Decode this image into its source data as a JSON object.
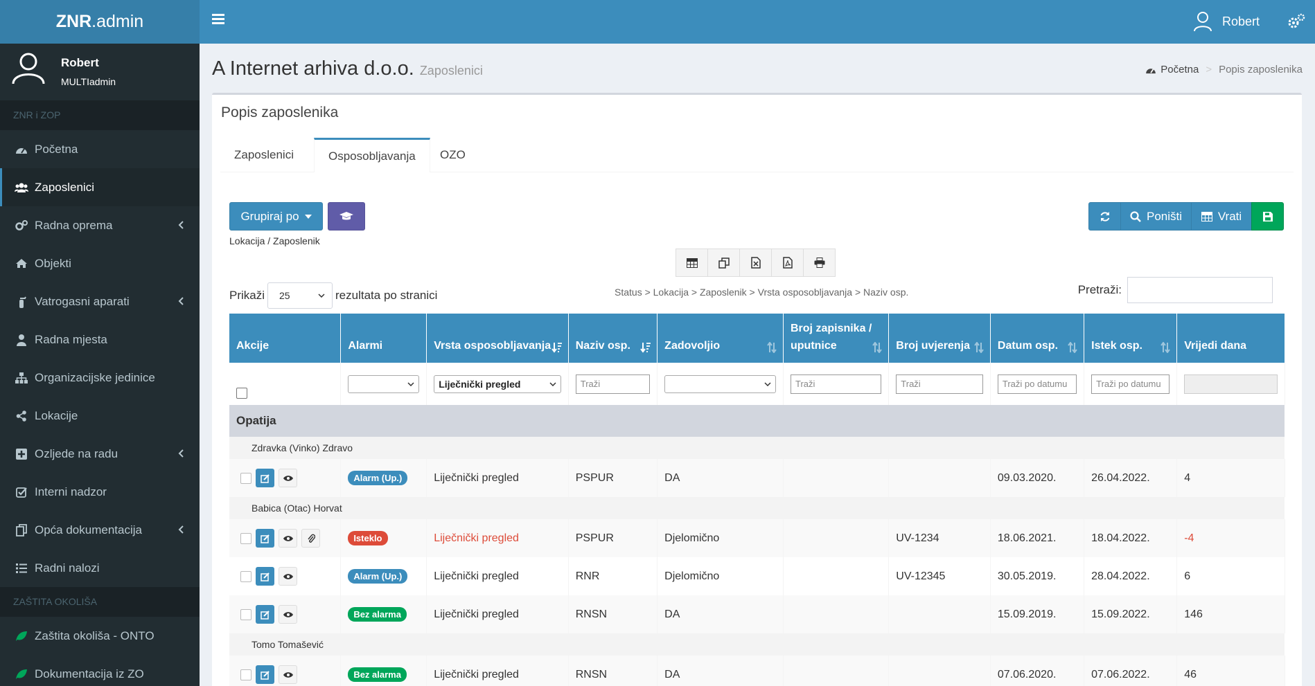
{
  "app": {
    "logo_bold": "ZNR",
    "logo_rest": ".admin"
  },
  "topbar": {
    "user": "Robert"
  },
  "user_panel": {
    "name": "Robert",
    "role": "MULTIadmin"
  },
  "sidebar": {
    "section1": "ZNR i ZOP",
    "items": [
      {
        "label": "Početna"
      },
      {
        "label": "Zaposlenici"
      },
      {
        "label": "Radna oprema"
      },
      {
        "label": "Objekti"
      },
      {
        "label": "Vatrogasni aparati"
      },
      {
        "label": "Radna mjesta"
      },
      {
        "label": "Organizacijske jedinice"
      },
      {
        "label": "Lokacije"
      },
      {
        "label": "Ozljede na radu"
      },
      {
        "label": "Interni nadzor"
      },
      {
        "label": "Opća dokumentacija"
      },
      {
        "label": "Radni nalozi"
      }
    ],
    "section2": "ZAŠTITA OKOLIŠA",
    "items2": [
      {
        "label": "Zaštita okoliša - ONTO"
      },
      {
        "label": "Dokumentacija iz ZO"
      }
    ]
  },
  "page": {
    "title": "A Internet arhiva d.o.o.",
    "subtitle": "Zaposlenici",
    "breadcrumb_home": "Početna",
    "breadcrumb_current": "Popis zaposlenika"
  },
  "box": {
    "title": "Popis zaposlenika",
    "tabs": [
      "Zaposlenici",
      "Osposobljavanja",
      "OZO"
    ],
    "group_button": "Grupiraj po",
    "group_label": "Lokacija / Zaposlenik",
    "reset_button": "Poništi",
    "restore_button": "Vrati"
  },
  "table_controls": {
    "show_prefix": "Prikaži",
    "page_length": "25",
    "show_suffix": "rezultata po stranici",
    "filter_path": "Status > Lokacija > Zaposlenik > Vrsta osposobljavanja > Naziv osp.",
    "search_label": "Pretraži:"
  },
  "table": {
    "headers": [
      "Akcije",
      "Alarmi",
      "Vrsta osposobljavanja",
      "Naziv osp.",
      "Zadovoljio",
      "Broj zapisnika / uputnice",
      "Broj uvjerenja",
      "Datum osp.",
      "Istek osp.",
      "Vrijedi dana"
    ],
    "filters": {
      "vrsta": "Liječnički pregled",
      "trazi": "Traži",
      "trazi_datum": "Traži po datumu"
    },
    "group": "Opatija",
    "employees": [
      "Zdravka (Vinko) Zdravo",
      "Babica (Otac) Horvat",
      "Tomo Tomašević"
    ],
    "rows": [
      {
        "alarm": "Alarm (Up.)",
        "vrsta": "Liječnički pregled",
        "naziv": "PSPUR",
        "zadovoljio": "DA",
        "zapisnik": "",
        "uvjerenje": "",
        "datum": "09.03.2020.",
        "istek": "26.04.2022.",
        "dana": "4"
      },
      {
        "alarm": "Isteklo",
        "vrsta": "Liječnički pregled",
        "naziv": "PSPUR",
        "zadovoljio": "Djelomično",
        "zapisnik": "",
        "uvjerenje": "UV-1234",
        "datum": "18.06.2021.",
        "istek": "18.04.2022.",
        "dana": "-4"
      },
      {
        "alarm": "Alarm (Up.)",
        "vrsta": "Liječnički pregled",
        "naziv": "RNR",
        "zadovoljio": "Djelomično",
        "zapisnik": "",
        "uvjerenje": "UV-12345",
        "datum": "30.05.2019.",
        "istek": "28.04.2022.",
        "dana": "6"
      },
      {
        "alarm": "Bez alarma",
        "vrsta": "Liječnički pregled",
        "naziv": "RNSN",
        "zadovoljio": "DA",
        "zapisnik": "",
        "uvjerenje": "",
        "datum": "15.09.2019.",
        "istek": "15.09.2022.",
        "dana": "146"
      },
      {
        "alarm": "Bez alarma",
        "vrsta": "Liječnički pregled",
        "naziv": "RNSN",
        "zadovoljio": "DA",
        "zapisnik": "",
        "uvjerenje": "",
        "datum": "07.06.2020.",
        "istek": "07.06.2022.",
        "dana": "46"
      }
    ]
  },
  "colors": {
    "primary": "#3c8dbc",
    "sidebar": "#222d32",
    "danger": "#dd4b39",
    "success": "#00a65a",
    "purple": "#605ca8"
  },
  "icons": [
    "bars-icon",
    "user-icon",
    "cogs-icon",
    "dashboard-icon",
    "users-icon",
    "home-icon",
    "sort-icon",
    "refresh-icon",
    "search-icon",
    "table-icon",
    "save-icon",
    "graduation-cap-icon",
    "edit-icon",
    "eye-icon",
    "paperclip-icon",
    "print-icon"
  ]
}
